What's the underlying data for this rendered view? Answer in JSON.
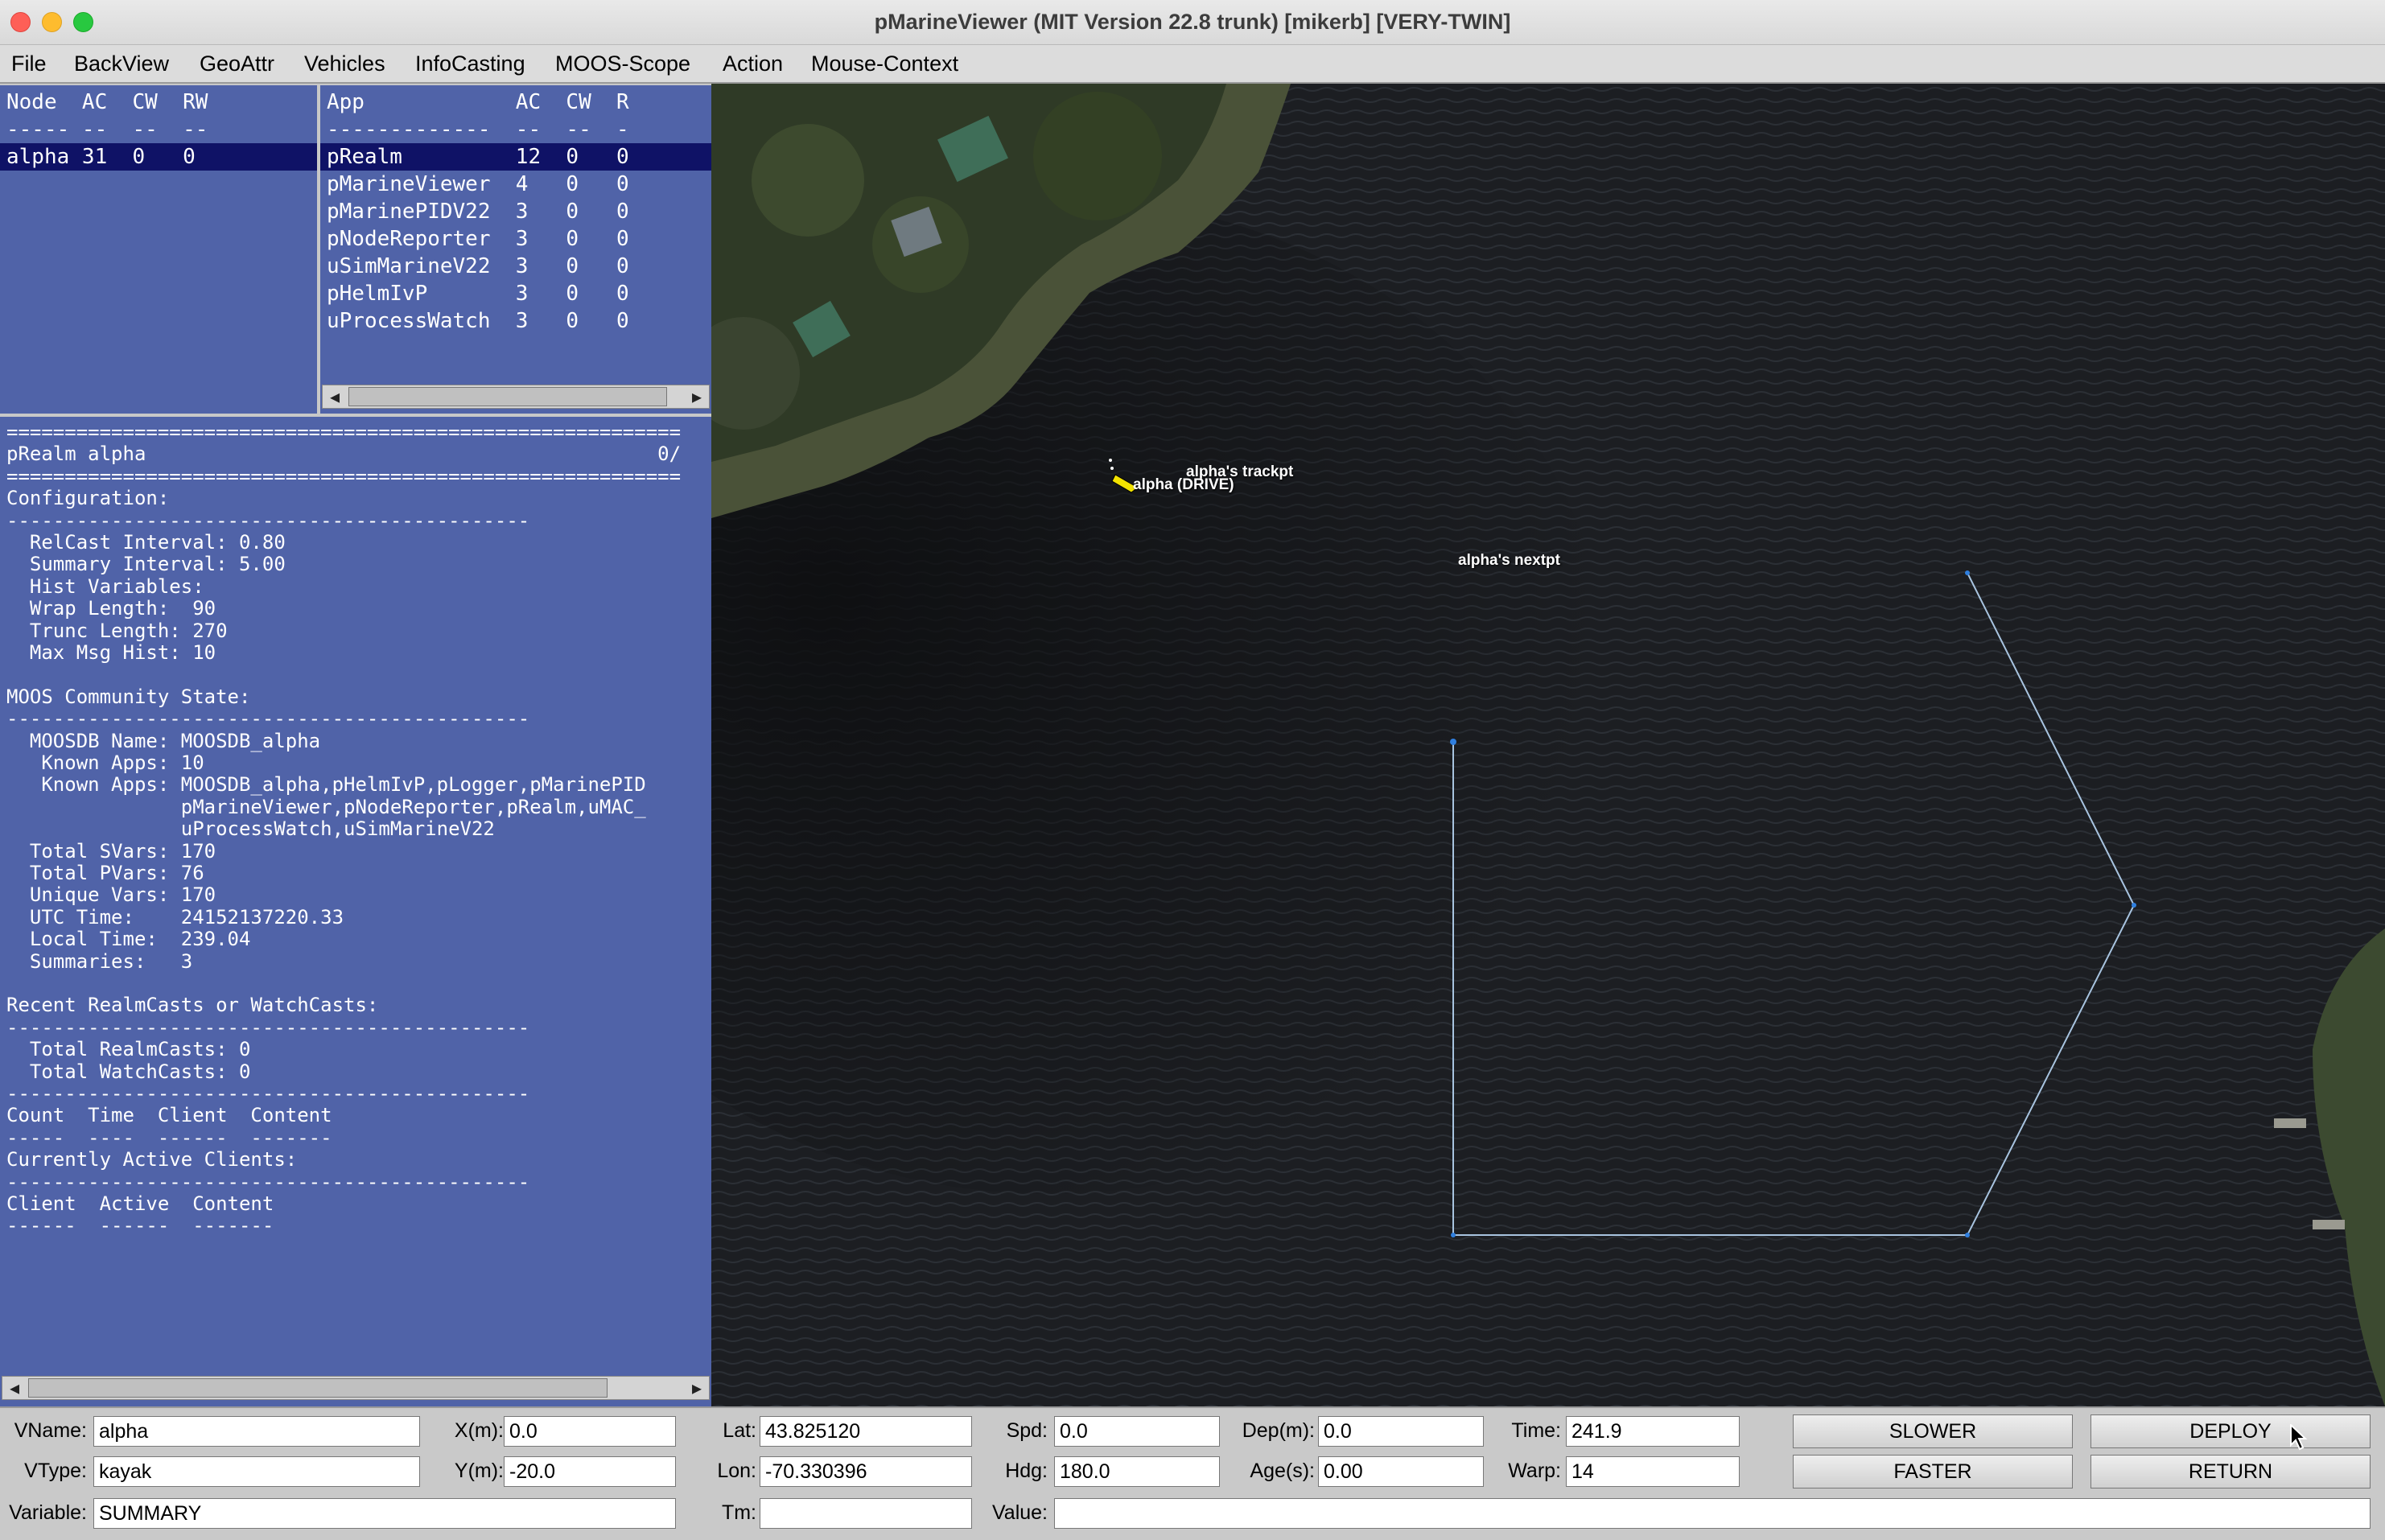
{
  "window": {
    "title": "pMarineViewer (MIT Version 22.8 trunk) [mikerb] [VERY-TWIN]"
  },
  "menu": [
    "File",
    "BackView",
    "GeoAttr",
    "Vehicles",
    "InfoCasting",
    "MOOS-Scope",
    "Action",
    "Mouse-Context"
  ],
  "node_table": {
    "header": "Node  AC  CW  RW",
    "divider": "----- --  --  --",
    "rows": [
      {
        "text": "alpha 31  0   0",
        "selected": true
      }
    ]
  },
  "app_table": {
    "header": "App            AC  CW  R",
    "divider": "-------------  --  --  -",
    "rows": [
      {
        "text": "pRealm         12  0   0",
        "selected": true
      },
      {
        "text": "pMarineViewer  4   0   0"
      },
      {
        "text": "pMarinePIDV22  3   0   0"
      },
      {
        "text": "pNodeReporter  3   0   0"
      },
      {
        "text": "uSimMarineV22  3   0   0"
      },
      {
        "text": "pHelmIvP       3   0   0"
      },
      {
        "text": "uProcessWatch  3   0   0"
      }
    ]
  },
  "realm_output": {
    "lines": [
      "==========================================================",
      "pRealm alpha                                            0/",
      "==========================================================",
      "Configuration:",
      "---------------------------------------------",
      "  RelCast Interval: 0.80",
      "  Summary Interval: 5.00",
      "  Hist Variables:",
      "  Wrap Length:  90",
      "  Trunc Length: 270",
      "  Max Msg Hist: 10",
      "",
      "MOOS Community State:",
      "---------------------------------------------",
      "  MOOSDB Name: MOOSDB_alpha",
      "   Known Apps: 10",
      "   Known Apps: MOOSDB_alpha,pHelmIvP,pLogger,pMarinePID",
      "               pMarineViewer,pNodeReporter,pRealm,uMAC_",
      "               uProcessWatch,uSimMarineV22",
      "  Total SVars: 170",
      "  Total PVars: 76",
      "  Unique Vars: 170",
      "  UTC Time:    24152137220.33",
      "  Local Time:  239.04",
      "  Summaries:   3",
      "",
      "Recent RealmCasts or WatchCasts:",
      "---------------------------------------------",
      "  Total RealmCasts: 0",
      "  Total WatchCasts: 0",
      "---------------------------------------------",
      "Count  Time  Client  Content",
      "-----  ----  ------  -------",
      "Currently Active Clients:",
      "---------------------------------------------",
      "Client  Active  Content",
      "------  ------  -------"
    ]
  },
  "map": {
    "vehicle_label": "alpha (DRIVE)",
    "trackpt_label": "alpha's trackpt",
    "nextpt_label": "alpha's nextpt",
    "path_color": "#a8c4e0",
    "vehicle_color": "#f2e200"
  },
  "controls": {
    "vname_label": "VName:",
    "vname": "alpha",
    "vtype_label": "VType:",
    "vtype": "kayak",
    "variable_label": "Variable:",
    "variable": "SUMMARY",
    "x_label": "X(m):",
    "x": "0.0",
    "y_label": "Y(m):",
    "y": "-20.0",
    "lat_label": "Lat:",
    "lat": "43.825120",
    "lon_label": "Lon:",
    "lon": "-70.330396",
    "tm_label": "Tm:",
    "tm": "",
    "spd_label": "Spd:",
    "spd": "0.0",
    "hdg_label": "Hdg:",
    "hdg": "180.0",
    "value_label": "Value:",
    "value": "",
    "dep_label": "Dep(m):",
    "dep": "0.0",
    "age_label": "Age(s):",
    "age": "0.00",
    "time_label": "Time:",
    "time": "241.9",
    "warp_label": "Warp:",
    "warp": "14",
    "slower": "SLOWER",
    "faster": "FASTER",
    "deploy": "DEPLOY",
    "return": "RETURN"
  }
}
